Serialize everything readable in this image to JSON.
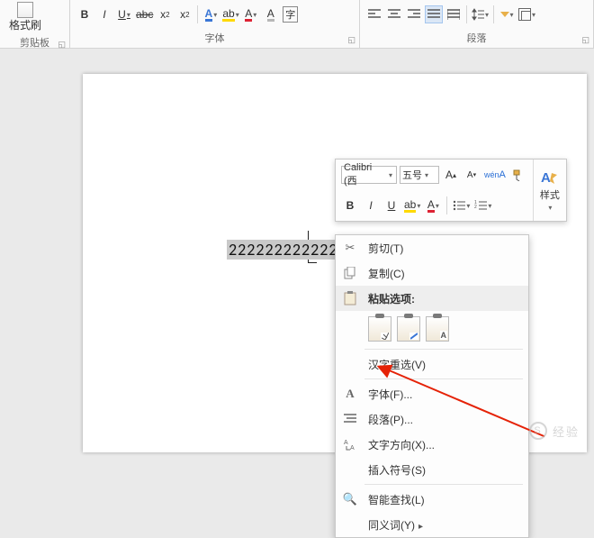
{
  "ribbon": {
    "clipboard": {
      "format_painter": "格式刷",
      "label": "剪贴板"
    },
    "font_group_label": "字体",
    "paragraph_group_label": "段落"
  },
  "document": {
    "selected_text": "222222222222"
  },
  "mini_toolbar": {
    "font_name": "Calibri (西",
    "font_size": "五号",
    "styles_label": "样式"
  },
  "context_menu": {
    "cut": "剪切(T)",
    "copy": "复制(C)",
    "paste_header": "粘贴选项:",
    "hanzi_reselect": "汉字重选(V)",
    "font": "字体(F)...",
    "paragraph": "段落(P)...",
    "text_direction": "文字方向(X)...",
    "insert_symbol": "插入符号(S)",
    "smart_lookup": "智能查找(L)",
    "synonyms": "同义词(Y)"
  },
  "watermark": "经验"
}
